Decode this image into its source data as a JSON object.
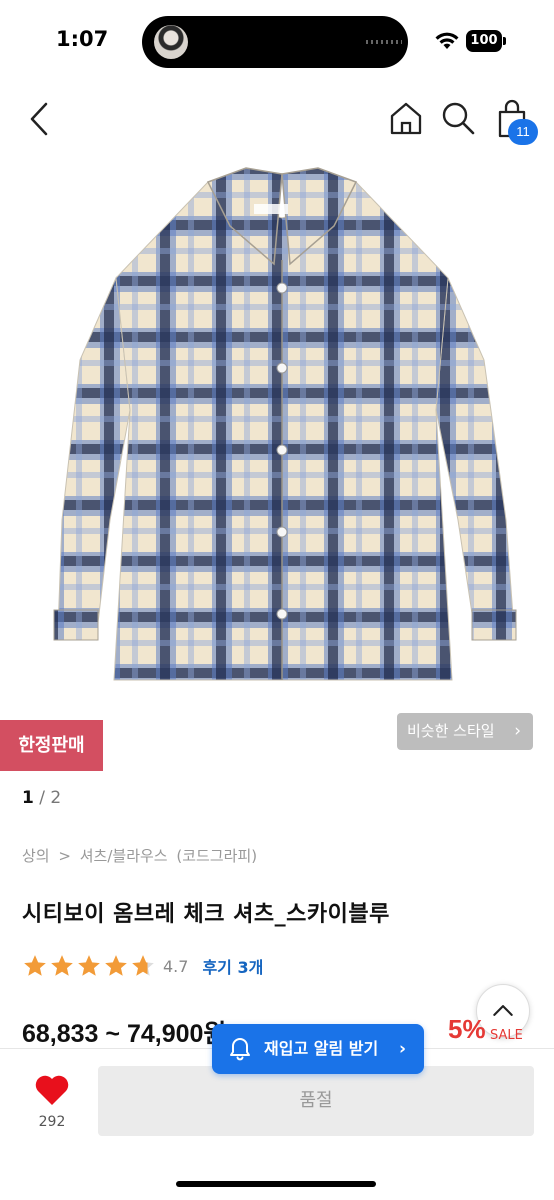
{
  "status_bar": {
    "time": "1:07",
    "battery": "100"
  },
  "nav": {
    "cart_count": "11"
  },
  "product": {
    "limited_badge": "한정판매",
    "similar_style": "비슷한 스타일",
    "page_current": "1",
    "page_sep": " / ",
    "page_total": "2",
    "breadcrumb": [
      "상의",
      ">",
      "셔츠/블라우스",
      "(코드그라피)"
    ],
    "title": "시티보이 옴브레 체크 셔츠_스카이블루",
    "rating": {
      "value": "4.7",
      "stars_level": 4.7,
      "review_link": "후기 3개"
    },
    "price": "68,833 ~ 74,900원",
    "discount": "5%",
    "sale_label": "SALE"
  },
  "bottom": {
    "restock_label": "재입고 알림 받기",
    "like_count": "292",
    "soldout_label": "품절"
  },
  "colors": {
    "accent_blue": "#1a73e8",
    "badge_red": "#d34f61",
    "sale_red": "#e53935",
    "star_orange": "#f29b38"
  }
}
